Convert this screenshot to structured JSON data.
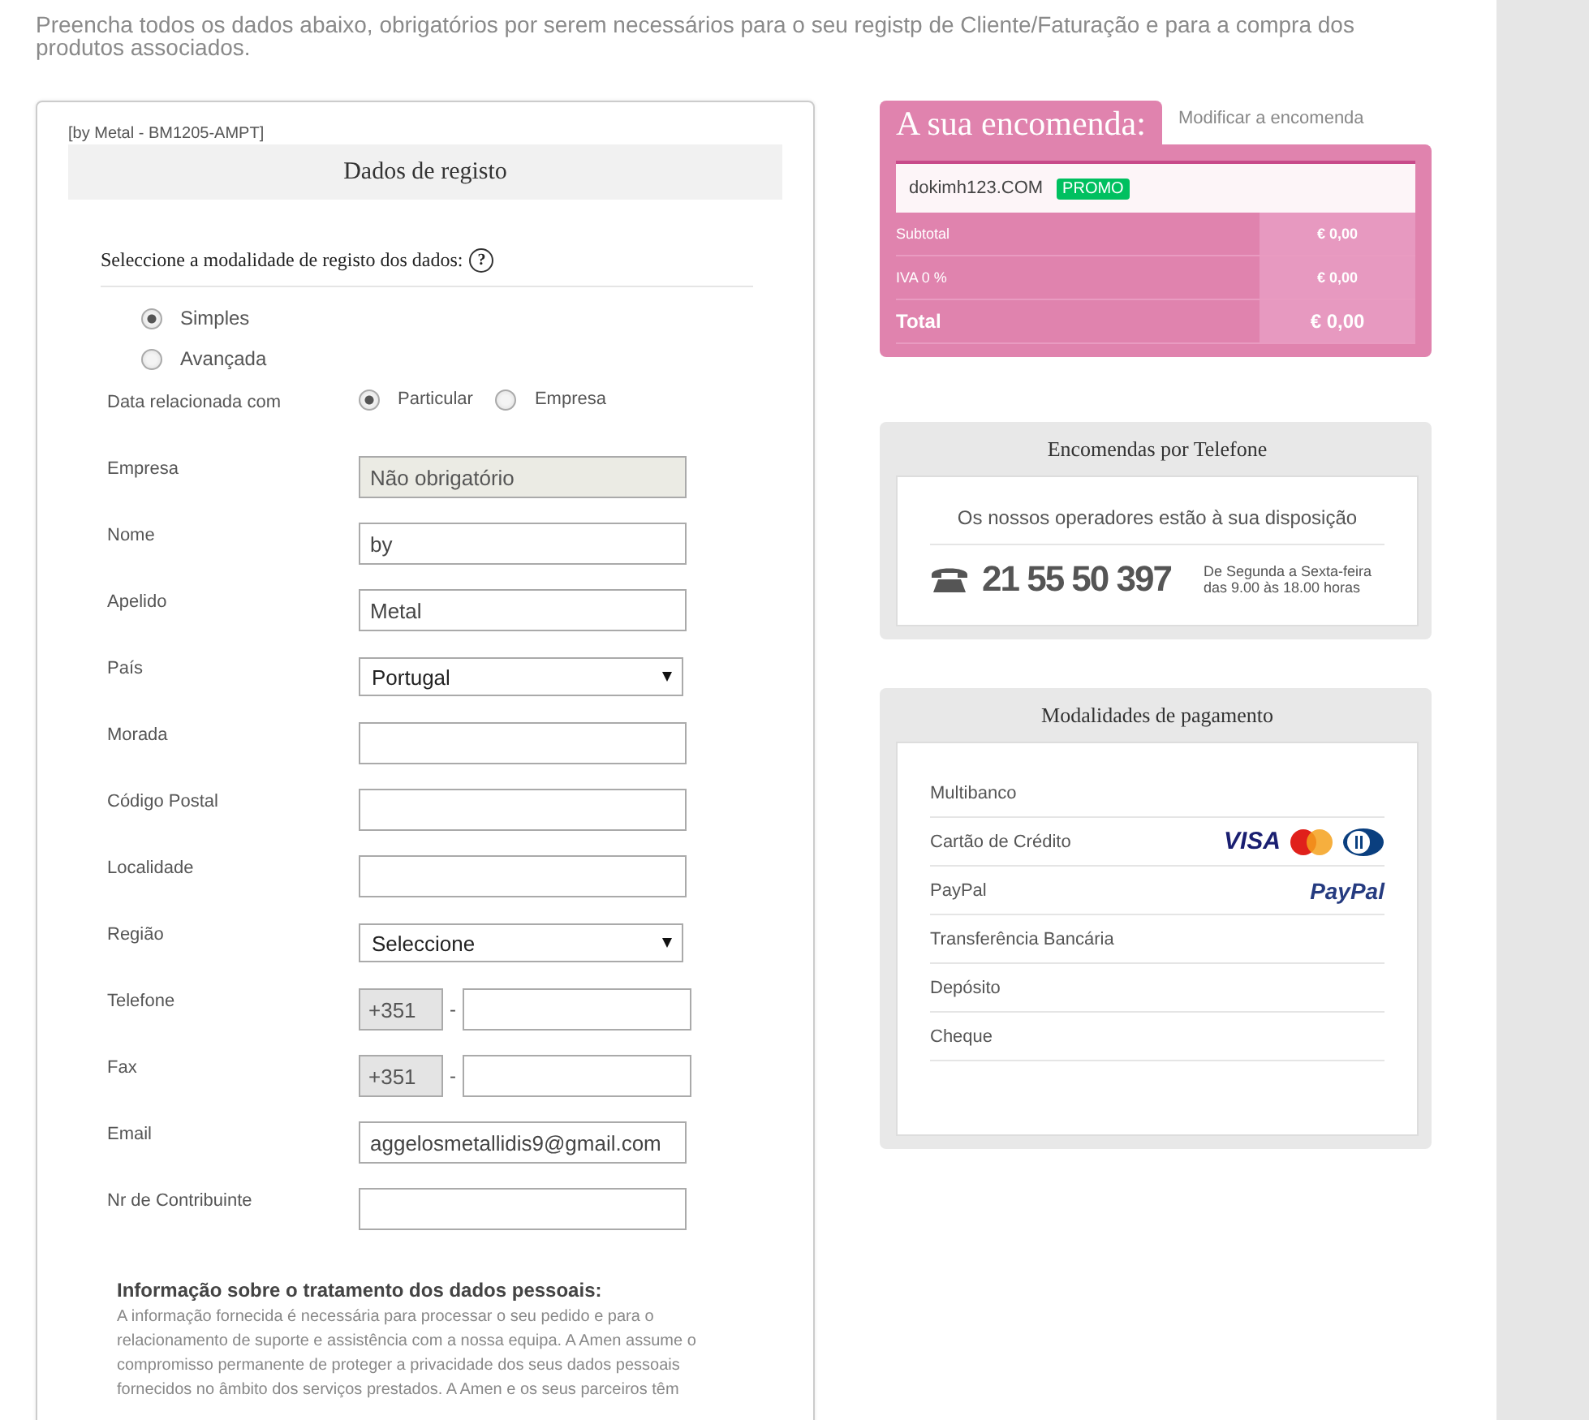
{
  "intro": "Preencha todos os dados abaixo, obrigatórios por serem necessários para o seu registp de Cliente/Faturação e para a compra dos produtos associados.",
  "form": {
    "reference": "[by Metal - BM1205-AMPT]",
    "title": "Dados de registo",
    "prompt": "Seleccione a modalidade de registo dos dados:",
    "help": "?",
    "modes": [
      {
        "label": "Simples",
        "selected": true
      },
      {
        "label": "Avançada",
        "selected": false
      }
    ],
    "relation": {
      "label": "Data relacionada com",
      "options": [
        {
          "label": "Particular",
          "selected": true
        },
        {
          "label": "Empresa",
          "selected": false
        }
      ]
    },
    "fields": [
      {
        "kind": "text",
        "label": "Empresa",
        "placeholder": "Não obrigatório",
        "disabled": true
      },
      {
        "kind": "text",
        "label": "Nome",
        "value": "by",
        "disabled": false
      },
      {
        "kind": "text",
        "label": "Apelido",
        "value": "Metal",
        "disabled": false
      },
      {
        "kind": "select",
        "label": "País",
        "value": "Portugal"
      },
      {
        "kind": "text",
        "label": "Morada",
        "disabled": false
      },
      {
        "kind": "text",
        "label": "Código Postal",
        "disabled": false
      },
      {
        "kind": "text",
        "label": "Localidade",
        "disabled": false
      },
      {
        "kind": "select",
        "label": "Região",
        "value": "Seleccione"
      },
      {
        "kind": "phone",
        "label": "Telefone",
        "prefix": "+351",
        "separator": "-"
      },
      {
        "kind": "phone",
        "label": "Fax",
        "prefix": "+351",
        "separator": "-"
      },
      {
        "kind": "text",
        "label": "Email",
        "value": "aggelosmetallidis9@gmail.com",
        "disabled": false
      },
      {
        "kind": "text",
        "label": "Nr de Contribuinte",
        "disabled": false
      }
    ],
    "privacy": {
      "title": "Informação sobre o tratamento dos dados pessoais:",
      "lines": [
        "A informação fornecida é necessária para processar o seu pedido e para o",
        "relacionamento de suporte e assistência com a nossa equipa. A Amen assume o",
        "compromisso permanente de proteger a privacidade dos seus dados pessoais",
        "fornecidos no âmbito dos serviços prestados. A Amen e os seus parceiros têm"
      ]
    }
  },
  "order": {
    "title": "A sua encomenda:",
    "modify_link": "Modificar a encomenda",
    "item": "dokimh123.COM",
    "badge": "PROMO",
    "rows": [
      {
        "kind": "normal",
        "label": "Subtotal",
        "value": "€ 0,00"
      },
      {
        "kind": "normal",
        "label": "IVA 0 %",
        "value": "€ 0,00"
      },
      {
        "kind": "total",
        "label": "Total",
        "value": "€ 0,00"
      }
    ]
  },
  "phone": {
    "title": "Encomendas por Telefone",
    "subtitle": "Os nossos operadores estão à sua disposição",
    "number": "21 55 50 397",
    "hours": [
      "De Segunda a Sexta-feira",
      "das 9.00 às 18.00 horas"
    ]
  },
  "payments": {
    "title": "Modalidades de pagamento",
    "methods": [
      {
        "label": "Multibanco",
        "kind": "plain"
      },
      {
        "label": "Cartão de Crédito",
        "kind": "cards",
        "logo_text": "VISA"
      },
      {
        "label": "PayPal",
        "kind": "paypal",
        "logo_text": "PayPal"
      },
      {
        "label": "Transferência Bancária",
        "kind": "plain"
      },
      {
        "label": "Depósito",
        "kind": "plain"
      },
      {
        "label": "Cheque",
        "kind": "plain"
      }
    ]
  }
}
